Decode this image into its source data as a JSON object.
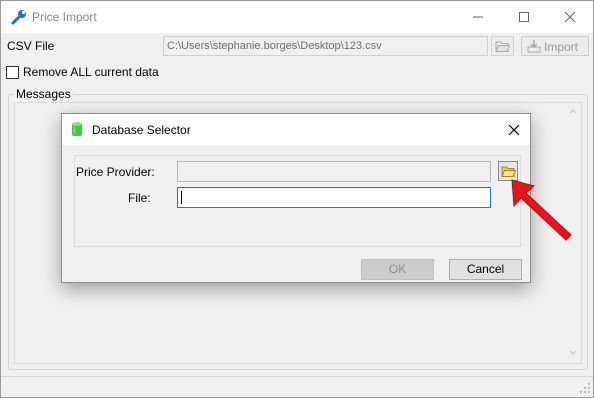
{
  "window": {
    "title": "Price Import",
    "app_icon": "wrench-icon",
    "controls": [
      "minimize-icon",
      "maximize-icon",
      "close-icon"
    ]
  },
  "form": {
    "csv_label": "CSV File",
    "csv_path": "C:\\Users\\stephanie.borges\\Desktop\\123.csv",
    "browse_icon": "folder-open-icon",
    "import_label": "Import",
    "import_icon": "import-icon",
    "remove_checkbox_label": "Remove ALL current data",
    "remove_checked": false,
    "messages_group_label": "Messages"
  },
  "dialog": {
    "title": "Database Selector",
    "icon": "database-icon",
    "price_provider_label": "Price Provider:",
    "price_provider_value": "",
    "file_label": "File:",
    "file_value": "",
    "ok_label": "OK",
    "cancel_label": "Cancel"
  },
  "annotation": {
    "icon": "red-arrow-icon",
    "color": "#e8141c"
  }
}
